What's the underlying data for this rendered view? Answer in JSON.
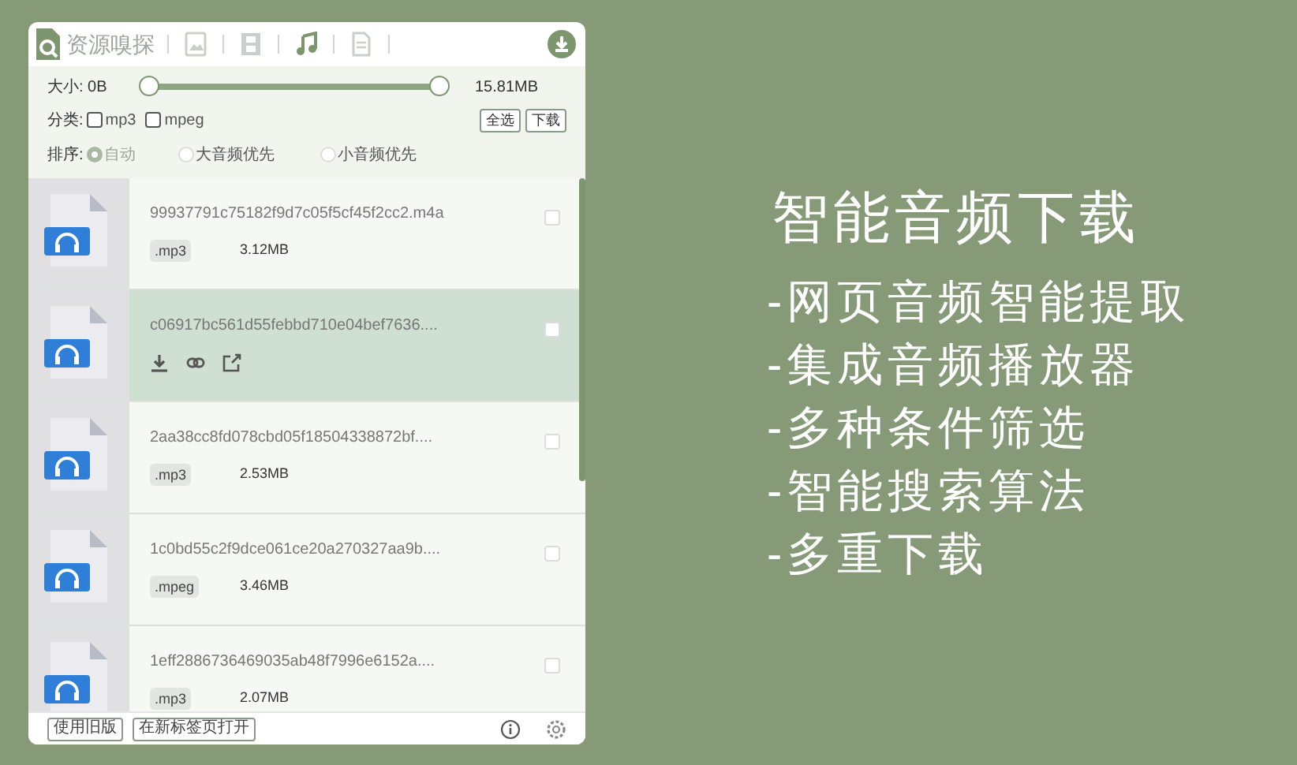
{
  "header": {
    "title": "资源嗅探",
    "tabs": [
      {
        "kind": "image",
        "selected": false
      },
      {
        "kind": "video",
        "selected": false
      },
      {
        "kind": "audio",
        "selected": true
      },
      {
        "kind": "document",
        "selected": false
      }
    ]
  },
  "filters": {
    "size_label": "大小:",
    "size_min": "0B",
    "size_max": "15.81MB",
    "low_thumb": {
      "level": 0
    },
    "high_thumb": {
      "level": 1
    },
    "category_label": "分类:",
    "categories": [
      {
        "label": "mp3",
        "checked": false
      },
      {
        "label": "mpeg",
        "checked": false
      }
    ],
    "buttons": [
      "全选",
      "下载"
    ],
    "sort_label": "排序:",
    "sort_options": [
      {
        "label": "自动",
        "selected": true
      },
      {
        "label": "大音频优先",
        "selected": false
      },
      {
        "label": "小音频优先",
        "selected": false
      }
    ]
  },
  "files": [
    {
      "name": "99937791c75182f9d7c05f5cf45f2cc2.m4a",
      "tag": ".mp3",
      "size": "3.12MB",
      "highlighted": false,
      "checked": false
    },
    {
      "name": "c06917bc561d55febbd710e04bef7636....",
      "highlighted": true,
      "checked": false
    },
    {
      "name": "2aa38cc8fd078cbd05f18504338872bf....",
      "tag": ".mp3",
      "size": "2.53MB",
      "highlighted": false,
      "checked": false
    },
    {
      "name": "1c0bd55c2f9dce061ce20a270327aa9b....",
      "tag": ".mpeg",
      "size": "3.46MB",
      "highlighted": false,
      "checked": false
    },
    {
      "name": "1eff2886736469035ab48f7996e6152a....",
      "tag": ".mp3",
      "size": "2.07MB",
      "highlighted": false,
      "checked": false
    }
  ],
  "footer": {
    "buttons": [
      "使用旧版",
      "在新标签页打开"
    ]
  },
  "promo": {
    "title": "智能音频下载",
    "features": [
      "-网页音频智能提取",
      "-集成音频播放器",
      "-多种条件筛选",
      "-智能搜索算法",
      "-多重下载"
    ]
  }
}
